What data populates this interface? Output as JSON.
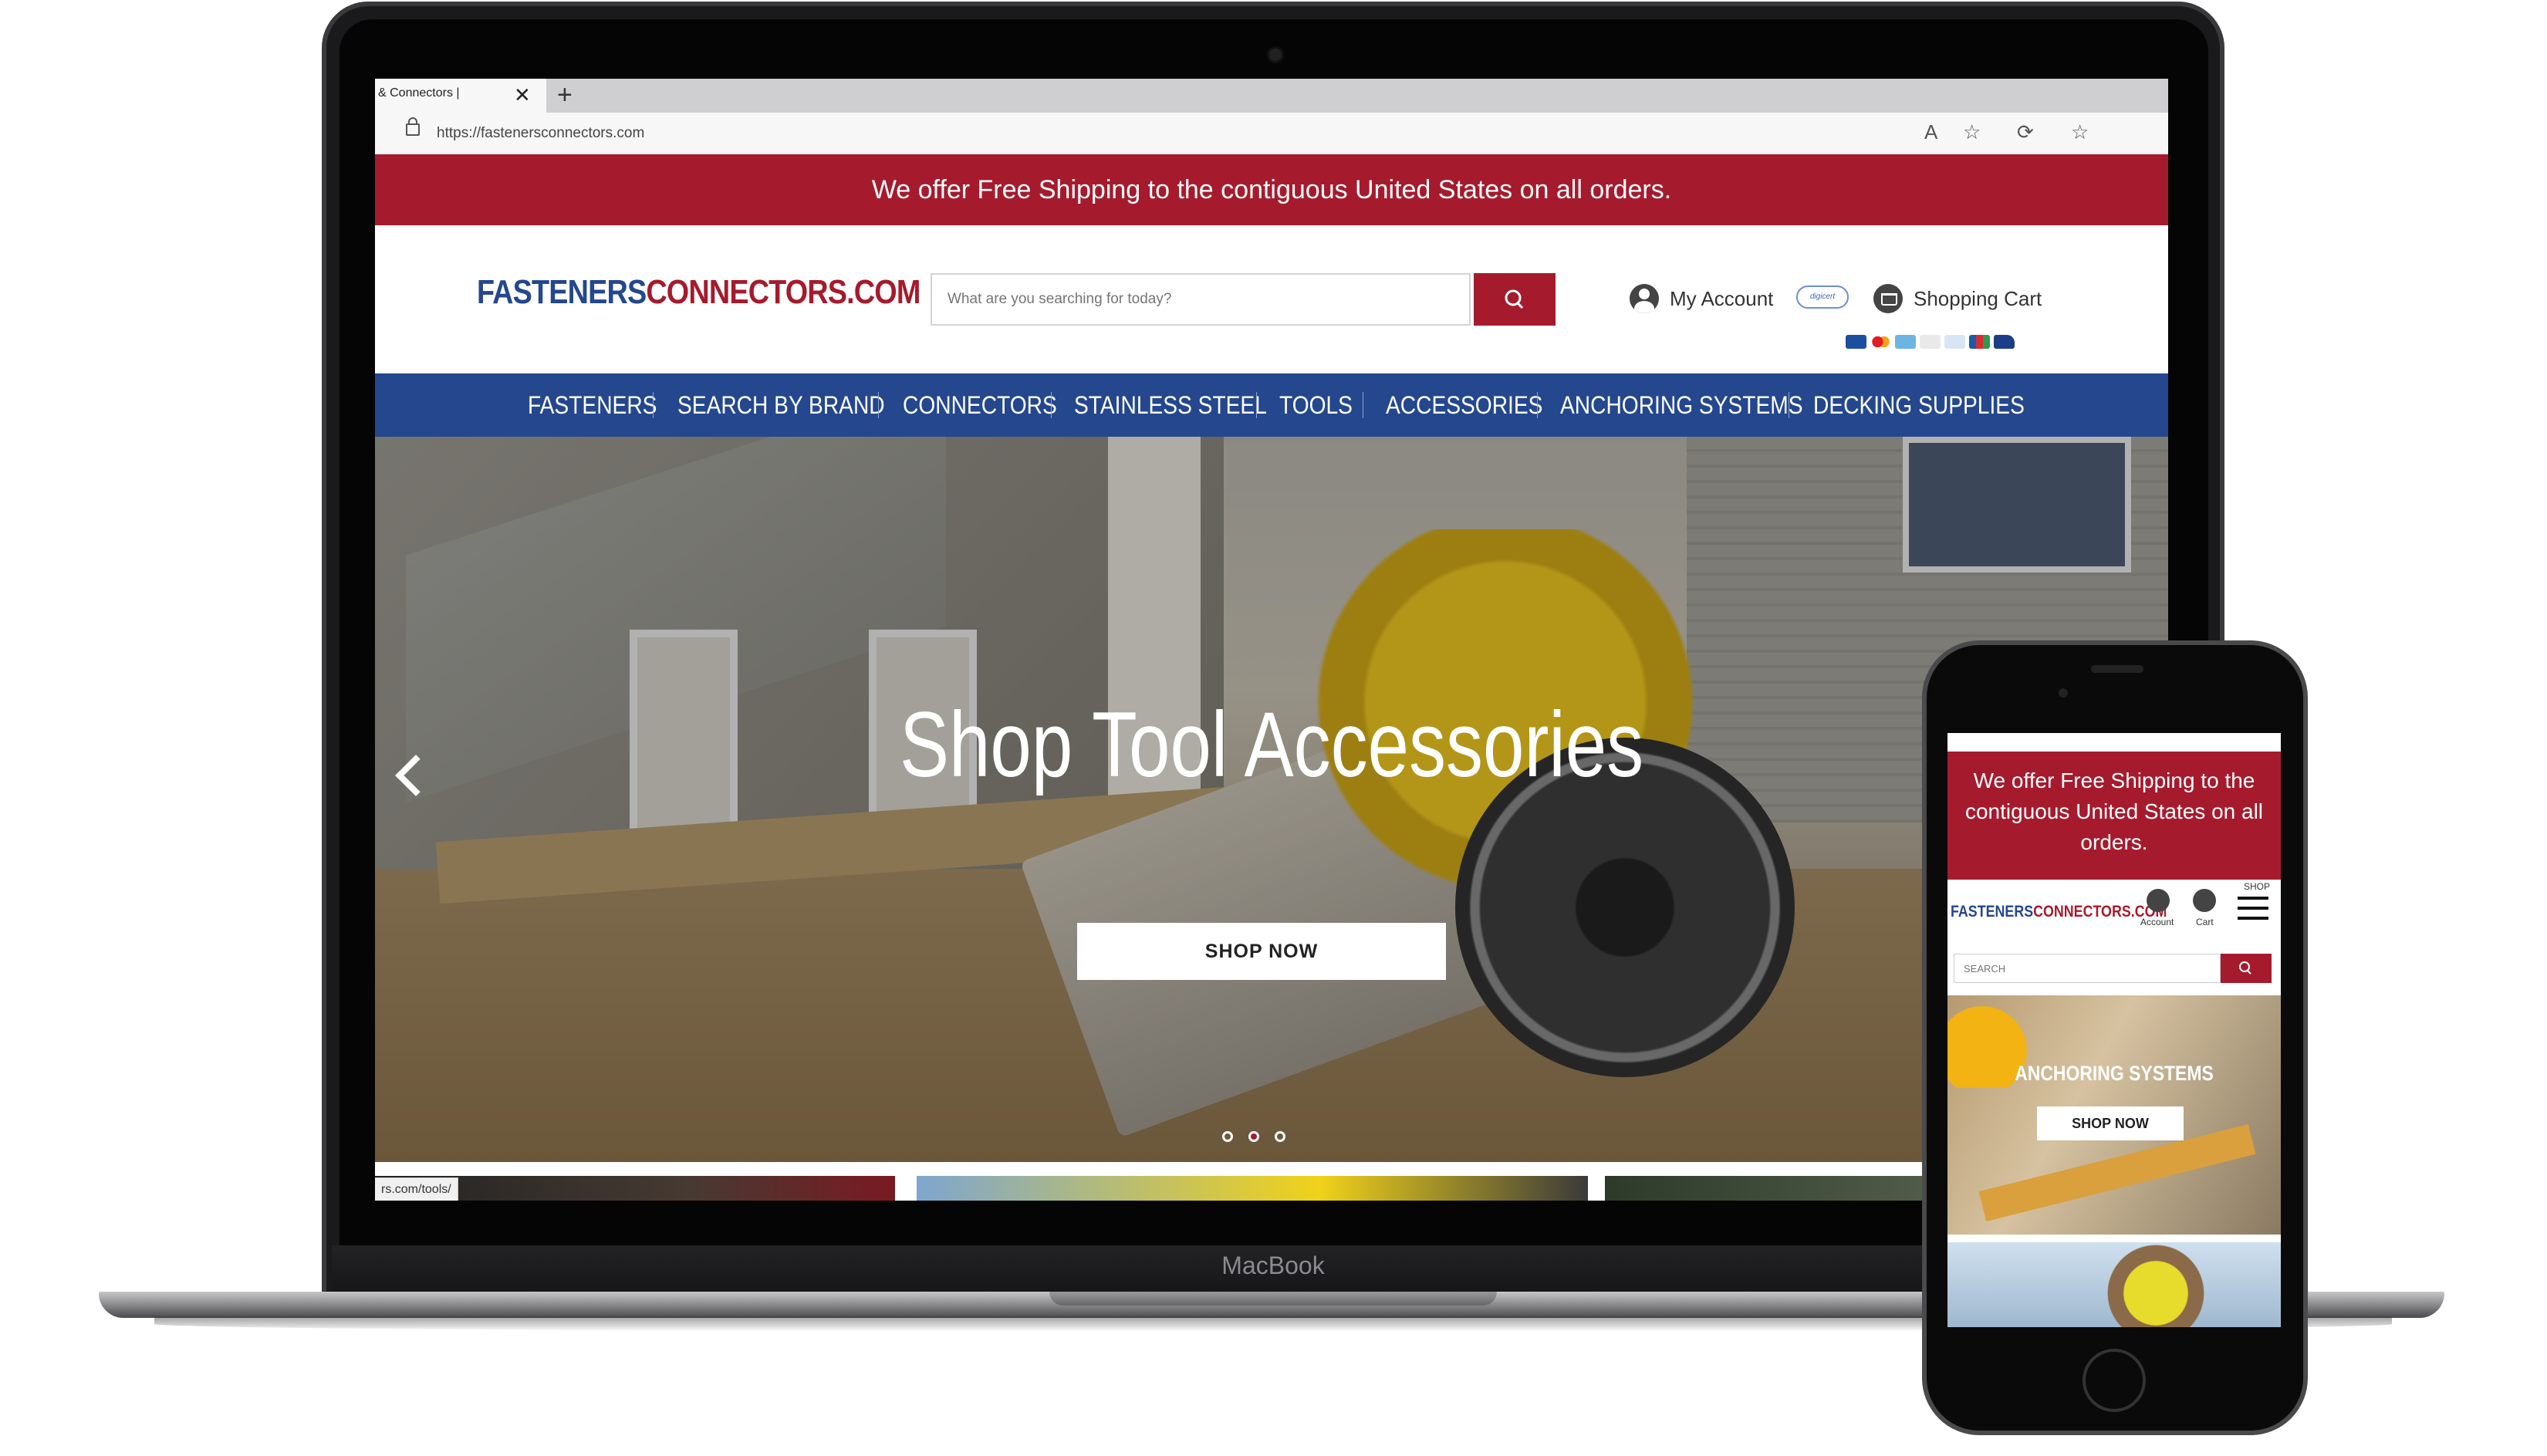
{
  "laptop": {
    "brand_label": "MacBook",
    "browser": {
      "tab_title": "& Connectors |",
      "tab_close": "✕",
      "tab_add": "+",
      "url": "https://fastenersconnectors.com",
      "status_url": "rs.com/tools/"
    },
    "site": {
      "announcement": "We offer Free Shipping to the contiguous United States on all orders.",
      "logo_part1": "FASTENERS",
      "logo_part2": "CONNECTORS.COM",
      "search_placeholder": "What are you searching for today?",
      "account_label": "My Account",
      "digicert_badge": "digicert",
      "cart_label": "Shopping Cart",
      "payment_icons": [
        "visa-icon",
        "mastercard-icon",
        "amex-icon",
        "discover-icon",
        "diners-icon",
        "jcb-icon",
        "paypal-icon"
      ],
      "nav": [
        "FASTENERS",
        "SEARCH BY BRAND",
        "CONNECTORS",
        "STAINLESS STEEL",
        "TOOLS",
        "ACCESSORIES",
        "ANCHORING SYSTEMS",
        "DECKING SUPPLIES"
      ],
      "hero": {
        "title": "Shop Tool Accessories",
        "button": "SHOP NOW",
        "slides": 3,
        "active_slide": 2
      }
    }
  },
  "phone": {
    "announcement": "We offer Free Shipping to the contiguous United States on all orders.",
    "logo_part1": "FASTENERS",
    "logo_part2": "CONNECTORS.COM",
    "account_label": "Account",
    "cart_label": "Cart",
    "shop_label": "SHOP",
    "search_placeholder": "SEARCH",
    "hero_title": "ANCHORING SYSTEMS",
    "hero_button": "SHOP NOW"
  },
  "colors": {
    "brand_red": "#a51b2d",
    "brand_blue": "#24478e"
  }
}
